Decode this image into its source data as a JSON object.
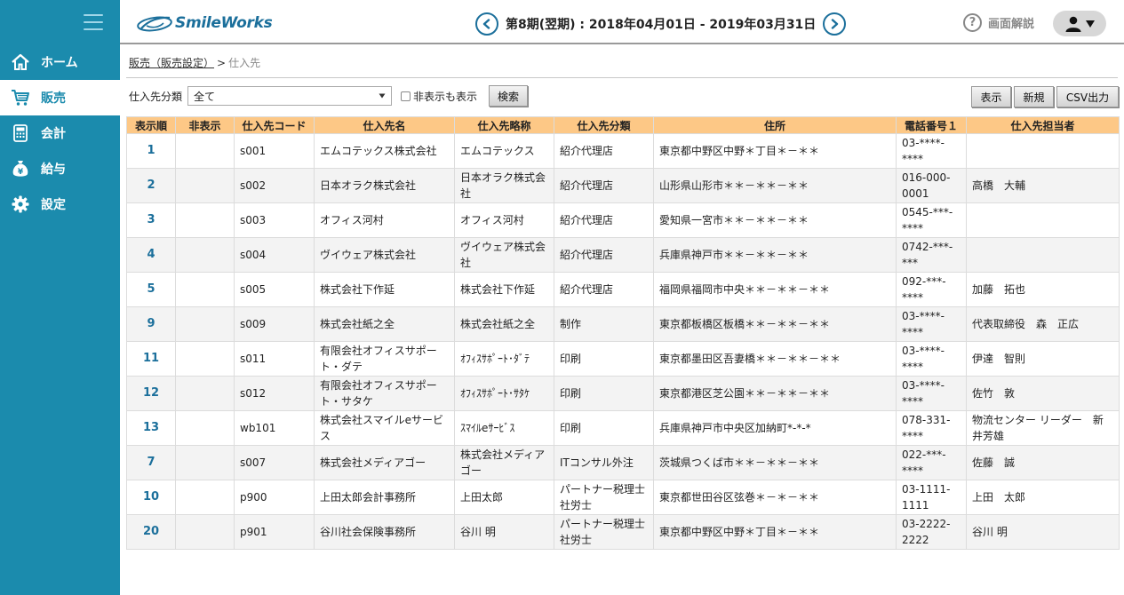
{
  "app": {
    "logo_text": "SmileWorks",
    "period_text": "第8期(翌期) : 2018年04月01日 - 2019年03月31日",
    "help_label": "画面解説"
  },
  "sidebar": {
    "items": [
      {
        "label": "ホーム",
        "icon": "home-icon",
        "active": false
      },
      {
        "label": "販売",
        "icon": "cart-icon",
        "active": true
      },
      {
        "label": "会計",
        "icon": "calculator-icon",
        "active": false
      },
      {
        "label": "給与",
        "icon": "money-bag-icon",
        "active": false
      },
      {
        "label": "設定",
        "icon": "gear-icon",
        "active": false
      }
    ]
  },
  "breadcrumb": {
    "parent": "販売（販売設定）",
    "separator": ">",
    "current": "仕入先"
  },
  "filter": {
    "category_label": "仕入先分類",
    "category_value": "全て",
    "show_hidden_label": "非表示も表示",
    "search_label": "検索"
  },
  "actions": {
    "show_label": "表示",
    "new_label": "新規",
    "csv_label": "CSV出力"
  },
  "table": {
    "headers": [
      "表示順",
      "非表示",
      "仕入先コード",
      "仕入先名",
      "仕入先略称",
      "仕入先分類",
      "住所",
      "電話番号１",
      "仕入先担当者"
    ],
    "rows": [
      {
        "order": "1",
        "hidden": "",
        "code": "s001",
        "name": "エムコテックス株式会社",
        "short": "エムコテックス",
        "category": "紹介代理店",
        "address": "東京都中野区中野＊丁目＊－＊＊",
        "phone": "03-****-****",
        "contact": "",
        "tall": false
      },
      {
        "order": "2",
        "hidden": "",
        "code": "s002",
        "name": "日本オラク株式会社",
        "short": "日本オラク株式会社",
        "category": "紹介代理店",
        "address": "山形県山形市＊＊－＊＊－＊＊",
        "phone": "016-000-0001",
        "contact": "高橋　大輔",
        "tall": true
      },
      {
        "order": "3",
        "hidden": "",
        "code": "s003",
        "name": "オフィス河村",
        "short": "オフィス河村",
        "category": "紹介代理店",
        "address": "愛知県一宮市＊＊－＊＊－＊＊",
        "phone": "0545-***-****",
        "contact": "",
        "tall": true
      },
      {
        "order": "4",
        "hidden": "",
        "code": "s004",
        "name": "ヴイウェア株式会社",
        "short": "ヴイウェア株式会社",
        "category": "紹介代理店",
        "address": "兵庫県神戸市＊＊－＊＊－＊＊",
        "phone": "0742-***-***",
        "contact": "",
        "tall": true
      },
      {
        "order": "5",
        "hidden": "",
        "code": "s005",
        "name": "株式会社下作延",
        "short": "株式会社下作延",
        "category": "紹介代理店",
        "address": "福岡県福岡市中央＊＊－＊＊－＊＊",
        "phone": "092-***-****",
        "contact": "加藤　拓也",
        "tall": false
      },
      {
        "order": "9",
        "hidden": "",
        "code": "s009",
        "name": "株式会社紙之全",
        "short": "株式会社紙之全",
        "category": "制作",
        "address": "東京都板橋区板橋＊＊－＊＊－＊＊",
        "phone": "03-****-****",
        "contact": "代表取締役　森　正広",
        "tall": false
      },
      {
        "order": "11",
        "hidden": "",
        "code": "s011",
        "name": "有限会社オフィスサポート・ダテ",
        "short": "ｵﾌｨｽｻﾎﾟｰﾄ･ﾀﾞﾃ",
        "category": "印刷",
        "address": "東京都墨田区吾妻橋＊＊－＊＊－＊＊",
        "phone": "03-****-****",
        "contact": "伊達　智則",
        "tall": true
      },
      {
        "order": "12",
        "hidden": "",
        "code": "s012",
        "name": "有限会社オフィスサポート・サタケ",
        "short": "ｵﾌｨｽｻﾎﾟｰﾄ･ｻﾀｹ",
        "category": "印刷",
        "address": "東京都港区芝公園＊＊－＊＊－＊＊",
        "phone": "03-****-****",
        "contact": "佐竹　敦",
        "tall": true
      },
      {
        "order": "13",
        "hidden": "",
        "code": "wb101",
        "name": "株式会社スマイルeサービス",
        "short": "ｽﾏｲﾙeｻｰﾋﾞｽ",
        "category": "印刷",
        "address": "兵庫県神戸市中央区加納町*-*-*",
        "phone": "078-331-****",
        "contact": "物流センター リーダー　新井芳雄",
        "tall": true
      },
      {
        "order": "7",
        "hidden": "",
        "code": "s007",
        "name": "株式会社メディアゴー",
        "short": "株式会社メディアゴー",
        "category": "ITコンサル外注",
        "address": "茨城県つくば市＊＊－＊＊－＊＊",
        "phone": "022-***-****",
        "contact": "佐藤　誠",
        "tall": true
      },
      {
        "order": "10",
        "hidden": "",
        "code": "p900",
        "name": "上田太郎会計事務所",
        "short": "上田太郎",
        "category": "パートナー税理士社労士",
        "address": "東京都世田谷区弦巻＊－＊－＊＊",
        "phone": "03-1111-1111",
        "contact": "上田　太郎",
        "tall": true
      },
      {
        "order": "20",
        "hidden": "",
        "code": "p901",
        "name": "谷川社会保険事務所",
        "short": "谷川 明",
        "category": "パートナー税理士社労士",
        "address": "東京都中野区中野＊丁目＊－＊＊",
        "phone": "03-2222-2222",
        "contact": "谷川 明",
        "tall": true
      }
    ]
  },
  "colors": {
    "sidebar_bg": "#1b8bad",
    "table_header_bg": "#fdc886",
    "accent": "#1b6f9b"
  }
}
